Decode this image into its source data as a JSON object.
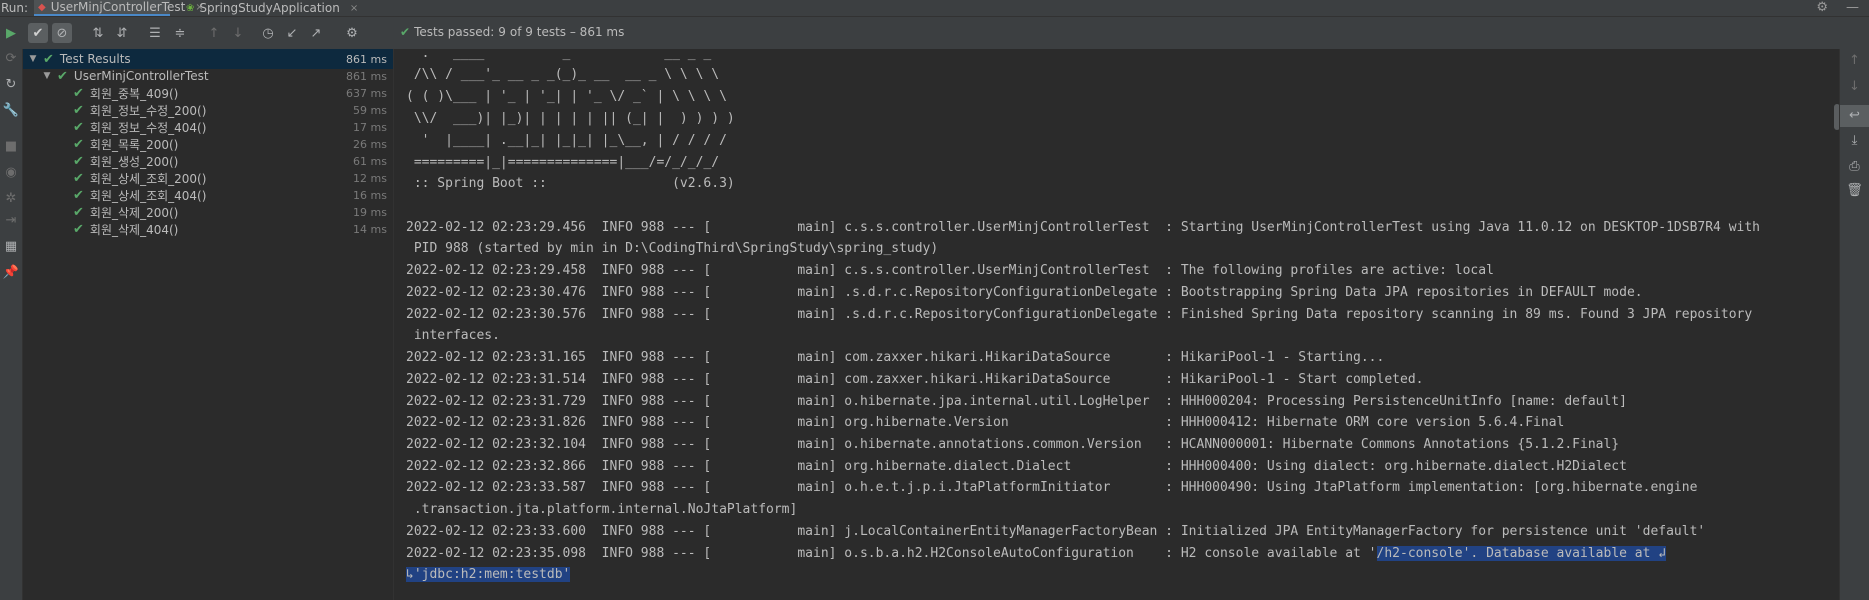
{
  "run_label": "Run:",
  "tabs": [
    {
      "label": "UserMinjControllerTest",
      "icon": "test-run-icon",
      "close": "×"
    },
    {
      "label": "SpringStudyApplication",
      "icon": "spring-icon",
      "close": "×"
    }
  ],
  "toolbar": {
    "status_label": "Tests passed:",
    "status_count": "9",
    "status_rest": "of 9 tests – 861 ms"
  },
  "tree": [
    {
      "label": "Test Results",
      "duration": "861 ms",
      "level": 0
    },
    {
      "label": "UserMinjControllerTest",
      "duration": "861 ms",
      "level": 1
    },
    {
      "label": "회원_중복_409()",
      "duration": "637 ms",
      "level": 2
    },
    {
      "label": "회원_정보_수정_200()",
      "duration": "59 ms",
      "level": 2
    },
    {
      "label": "회원_정보_수정_404()",
      "duration": "17 ms",
      "level": 2
    },
    {
      "label": "회원_목록_200()",
      "duration": "26 ms",
      "level": 2
    },
    {
      "label": "회원_생성_200()",
      "duration": "61 ms",
      "level": 2
    },
    {
      "label": "회원_상세_조회_200()",
      "duration": "12 ms",
      "level": 2
    },
    {
      "label": "회원_상세_조회_404()",
      "duration": "16 ms",
      "level": 2
    },
    {
      "label": "회원_삭제_200()",
      "duration": "19 ms",
      "level": 2
    },
    {
      "label": "회원_삭제_404()",
      "duration": "14 ms",
      "level": 2
    }
  ],
  "console": [
    "  .   ____          _            __ _ _",
    " /\\\\ / ___'_ __ _ _(_)_ __  __ _ \\ \\ \\ \\",
    "( ( )\\___ | '_ | '_| | '_ \\/ _` | \\ \\ \\ \\",
    " \\\\/  ___)| |_)| | | | | || (_| |  ) ) ) )",
    "  '  |____| .__|_| |_|_| |_\\__, | / / / /",
    " =========|_|==============|___/=/_/_/_/",
    " :: Spring Boot ::                (v2.6.3)",
    "",
    "2022-02-12 02:23:29.456  INFO 988 --- [           main] c.s.s.controller.UserMinjControllerTest  : Starting UserMinjControllerTest using Java 11.0.12 on DESKTOP-1DSB7R4 with",
    " PID 988 (started by min in D:\\CodingThird\\SpringStudy\\spring_study)",
    "2022-02-12 02:23:29.458  INFO 988 --- [           main] c.s.s.controller.UserMinjControllerTest  : The following profiles are active: local",
    "2022-02-12 02:23:30.476  INFO 988 --- [           main] .s.d.r.c.RepositoryConfigurationDelegate : Bootstrapping Spring Data JPA repositories in DEFAULT mode.",
    "2022-02-12 02:23:30.576  INFO 988 --- [           main] .s.d.r.c.RepositoryConfigurationDelegate : Finished Spring Data repository scanning in 89 ms. Found 3 JPA repository",
    " interfaces.",
    "2022-02-12 02:23:31.165  INFO 988 --- [           main] com.zaxxer.hikari.HikariDataSource       : HikariPool-1 - Starting...",
    "2022-02-12 02:23:31.514  INFO 988 --- [           main] com.zaxxer.hikari.HikariDataSource       : HikariPool-1 - Start completed.",
    "2022-02-12 02:23:31.729  INFO 988 --- [           main] o.hibernate.jpa.internal.util.LogHelper  : HHH000204: Processing PersistenceUnitInfo [name: default]",
    "2022-02-12 02:23:31.826  INFO 988 --- [           main] org.hibernate.Version                    : HHH000412: Hibernate ORM core version 5.6.4.Final",
    "2022-02-12 02:23:32.104  INFO 988 --- [           main] o.hibernate.annotations.common.Version   : HCANN000001: Hibernate Commons Annotations {5.1.2.Final}",
    "2022-02-12 02:23:32.866  INFO 988 --- [           main] org.hibernate.dialect.Dialect            : HHH000400: Using dialect: org.hibernate.dialect.H2Dialect",
    "2022-02-12 02:23:33.587  INFO 988 --- [           main] o.h.e.t.j.p.i.JtaPlatformInitiator       : HHH000490: Using JtaPlatform implementation: [org.hibernate.engine",
    " .transaction.jta.platform.internal.NoJtaPlatform]",
    "2022-02-12 02:23:33.600  INFO 988 --- [           main] j.LocalContainerEntityManagerFactoryBean : Initialized JPA EntityManagerFactory for persistence unit 'default'"
  ],
  "console_last": {
    "plain": "2022-02-12 02:23:35.098  INFO 988 --- [           main] o.s.b.a.h2.H2ConsoleAutoConfiguration    : H2 console available at '",
    "selected": "/h2-console'. Database available at ↲",
    "continued": "↳'jdbc:h2:mem:testdb'"
  }
}
